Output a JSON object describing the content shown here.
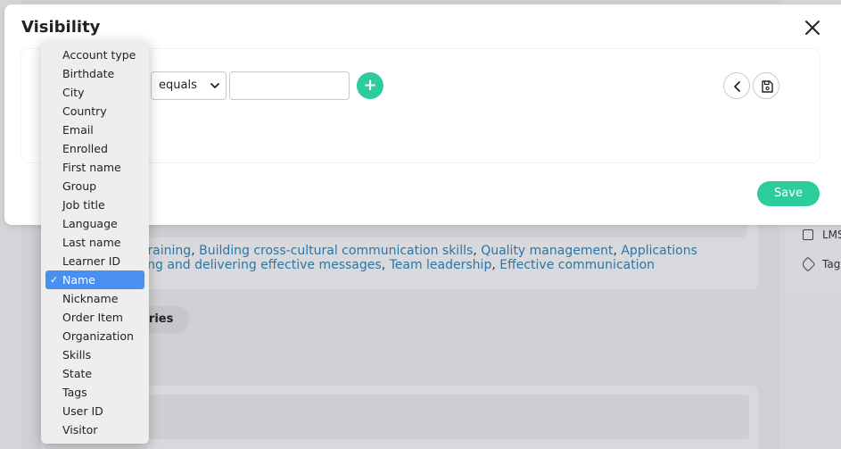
{
  "modal": {
    "title": "Visibility",
    "operator": "equals",
    "value_placeholder": "",
    "add_label": "+",
    "save_label": "Save"
  },
  "dropdown": {
    "items": [
      "Account type",
      "Birthdate",
      "City",
      "Country",
      "Email",
      "Enrolled",
      "First name",
      "Group",
      "Job title",
      "Language",
      "Last name",
      "Learner ID",
      "Name",
      "Nickname",
      "Order Item",
      "Organization",
      "Skills",
      "State",
      "Tags",
      "User ID",
      "Visitor"
    ],
    "selected": "Name",
    "check_mark": "✓"
  },
  "background": {
    "links_line1_prefix": "t training",
    "links_line1": [
      "Building cross-cultural communication skills",
      "Quality management",
      "Applications"
    ],
    "links_line2_prefix": "rting and delivering effective messages",
    "links_line2": [
      "Team leadership",
      "Effective communication"
    ],
    "chip_label": "ories",
    "right_items": [
      "LMS",
      "Tag"
    ]
  },
  "colors": {
    "accent": "#2dcc9c",
    "selection": "#4a90f0",
    "link": "#2a76a8"
  }
}
